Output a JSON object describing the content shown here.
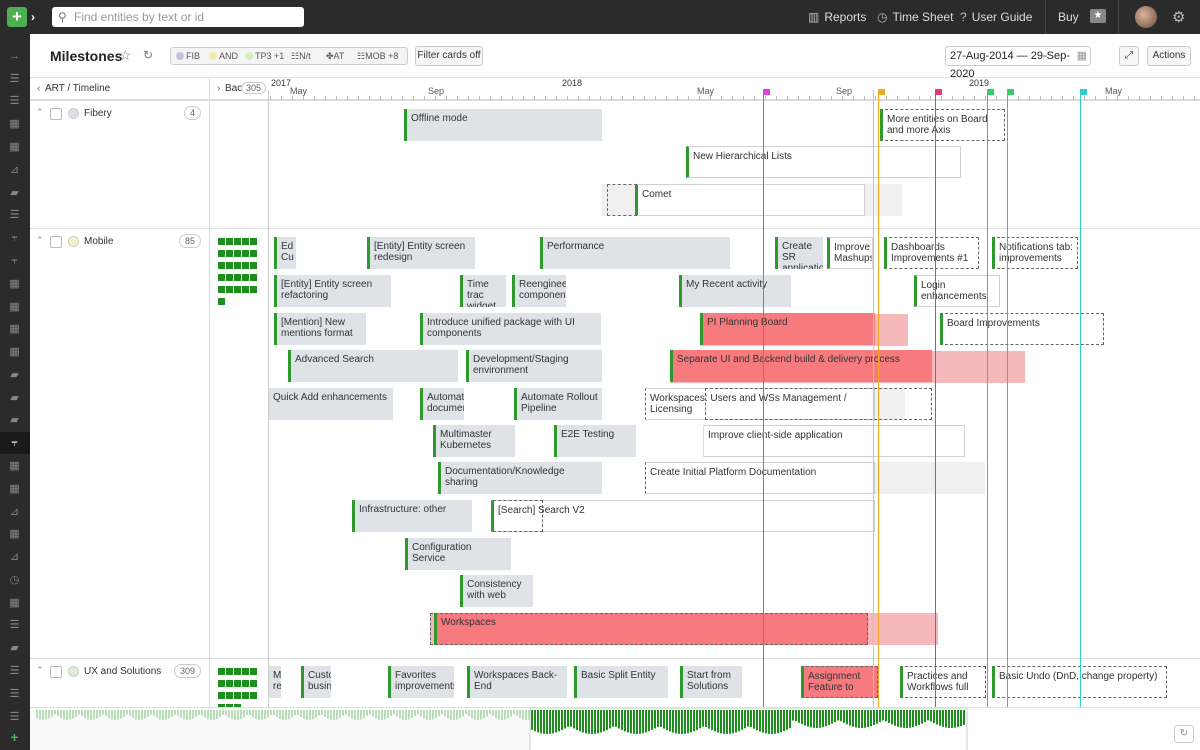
{
  "topbar": {
    "search_placeholder": "Find entities by text or id",
    "nav": [
      {
        "icon": "reports-icon",
        "label": "Reports"
      },
      {
        "icon": "timesheet-icon",
        "label": "Time Sheet"
      },
      {
        "icon": "help-icon",
        "label": "User Guide"
      },
      {
        "label": "Buy"
      }
    ]
  },
  "header": {
    "title": "Milestones",
    "filters": [
      {
        "label": "FIB",
        "color": "#c9c0e0"
      },
      {
        "label": "AND",
        "color": "#f2efa8"
      },
      {
        "label": "TP3",
        "color": "#d8ecc2",
        "extra": "+1"
      },
      {
        "label": "N/t",
        "icon": "team-icon"
      },
      {
        "label": "AT",
        "icon": "puzzle-icon"
      },
      {
        "label": "MOB",
        "icon": "team-icon",
        "extra": "+8"
      }
    ],
    "filter_cards_button": "Filter cards off",
    "date_range": "27-Aug-2014 — 29-Sep-2020",
    "actions_button": "Actions"
  },
  "timeline": {
    "left_label": "ART / Timeline",
    "backlog_label": "Bac",
    "backlog_count": "305",
    "years": [
      "2017",
      "2018",
      "2019"
    ],
    "months": [
      "May",
      "Sep",
      "May",
      "Sep",
      "May"
    ]
  },
  "groups": [
    {
      "name": "Fibery",
      "count": "4",
      "color": "#e2dcef"
    },
    {
      "name": "Mobile",
      "count": "85",
      "color": "#f5f3c4"
    },
    {
      "name": "UX and Solutions",
      "count": "309",
      "color": "#dcefd0"
    }
  ],
  "cards": [
    {
      "text": "Offline mode"
    },
    {
      "text": "More entities on Board and more Axis"
    },
    {
      "text": "New Hierarchical Lists"
    },
    {
      "text": "Comet"
    },
    {
      "text": "Ed Cu"
    },
    {
      "text": "[Entity] Entity screen redesign"
    },
    {
      "text": "Performance"
    },
    {
      "text": "Create SR applicatio"
    },
    {
      "text": "Improve Mashups"
    },
    {
      "text": "Dashboards Improvements #1"
    },
    {
      "text": "Notifications tab: improvements"
    },
    {
      "text": "[Entity] Entity screen refactoring"
    },
    {
      "text": "Time trac widget"
    },
    {
      "text": "Reengineer component"
    },
    {
      "text": "My Recent activity"
    },
    {
      "text": "Login enhancements"
    },
    {
      "text": "[Mention] New mentions format"
    },
    {
      "text": "Introduce unified package with UI components"
    },
    {
      "text": "PI Planning Board"
    },
    {
      "text": "Board Improvements"
    },
    {
      "text": "Advanced Search"
    },
    {
      "text": "Development/Staging environment"
    },
    {
      "text": "Separate UI and Backend build & delivery process"
    },
    {
      "text": "Quick Add enhancements"
    },
    {
      "text": "Automat documen"
    },
    {
      "text": "Automate Rollout Pipeline"
    },
    {
      "text": "Workspaces: Users and WSs Management / Licensing"
    },
    {
      "text": "Multimaster Kubernetes"
    },
    {
      "text": "E2E Testing"
    },
    {
      "text": "Improve client-side application"
    },
    {
      "text": "Documentation/Knowledge sharing"
    },
    {
      "text": "Create Initial Platform Documentation"
    },
    {
      "text": "Infrastructure: other"
    },
    {
      "text": "[Search] Search V2"
    },
    {
      "text": "Configuration Service"
    },
    {
      "text": "Consistency with web"
    },
    {
      "text": "Workspaces"
    },
    {
      "text": "M re"
    },
    {
      "text": "Custo busin"
    },
    {
      "text": "Favorites improvements"
    },
    {
      "text": "Workspaces Back-End"
    },
    {
      "text": "Basic Split Entity"
    },
    {
      "text": "Start from Solutions"
    },
    {
      "text": "Assignment Feature to"
    },
    {
      "text": "Practices and Workflows full"
    },
    {
      "text": "Basic Undo (DnD, change property)"
    }
  ],
  "colors": {
    "accent_green": "#2e9a2e",
    "red_card": "#f77a7e",
    "marker_magenta": "#e040e0",
    "marker_orange": "#f5a623",
    "marker_pink": "#ee3377",
    "marker_green": "#33cc66",
    "marker_teal": "#33cccc"
  }
}
